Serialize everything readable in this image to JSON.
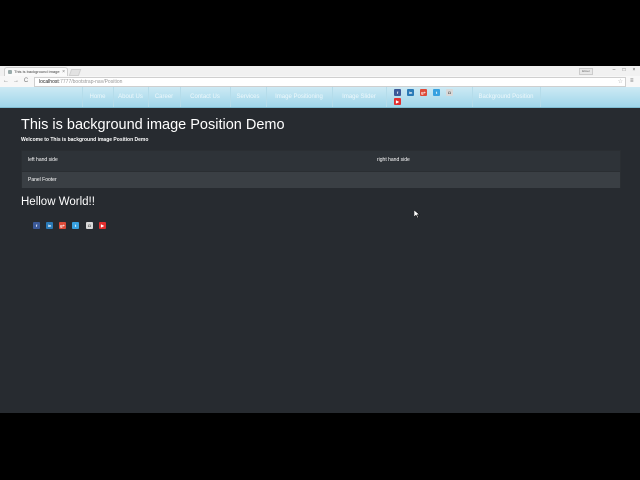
{
  "browser": {
    "tab_title": "This is background image",
    "tab_close": "×",
    "user_badge": "Elmer",
    "window_buttons": [
      "–",
      "□",
      "×"
    ],
    "nav_back": "←",
    "nav_forward": "→",
    "nav_reload": "C",
    "url_host": "localhost",
    "url_path": ":7777/bootstrap-nav/Position",
    "star": "☆",
    "menu": "≡"
  },
  "navbar": {
    "items": [
      "Home",
      "About Us",
      "Career",
      "Contact Us",
      "Services",
      "Image Positioning",
      "Image Slider",
      "Background Position"
    ],
    "social": [
      {
        "name": "facebook-icon",
        "glyph": "f",
        "color": "#3b5998"
      },
      {
        "name": "linkedin-icon",
        "glyph": "in",
        "color": "#2a7ab7"
      },
      {
        "name": "googleplus-icon",
        "glyph": "g+",
        "color": "#dd4b39"
      },
      {
        "name": "twitter-icon",
        "glyph": "t",
        "color": "#38a1e0"
      },
      {
        "name": "instagram-icon",
        "glyph": "◘",
        "color": "#d8d8d8"
      },
      {
        "name": "youtube-icon",
        "glyph": "▶",
        "color": "#e22e2e"
      }
    ]
  },
  "main": {
    "title": "This is background image Position Demo",
    "welcome": "Welcome to This is background image Position Demo",
    "panel": {
      "left": "left hand side",
      "right": "right hand side",
      "footer": "Panel Footer"
    },
    "hello": "Hellow World!!",
    "icons": [
      {
        "name": "facebook-icon",
        "glyph": "f",
        "color": "#3b5998"
      },
      {
        "name": "linkedin-icon",
        "glyph": "in",
        "color": "#2a7ab7"
      },
      {
        "name": "googleplus-icon",
        "glyph": "g+",
        "color": "#dd4b39"
      },
      {
        "name": "twitter-icon",
        "glyph": "t",
        "color": "#38a1e0"
      },
      {
        "name": "instagram-icon",
        "glyph": "◘",
        "color": "#d8d8d8"
      },
      {
        "name": "youtube-icon",
        "glyph": "▶",
        "color": "#e22e2e"
      }
    ]
  },
  "colors": {
    "page_bg": "#272b30",
    "navbar_top": "#cdeaf4",
    "navbar_bottom": "#9fd6ea"
  }
}
